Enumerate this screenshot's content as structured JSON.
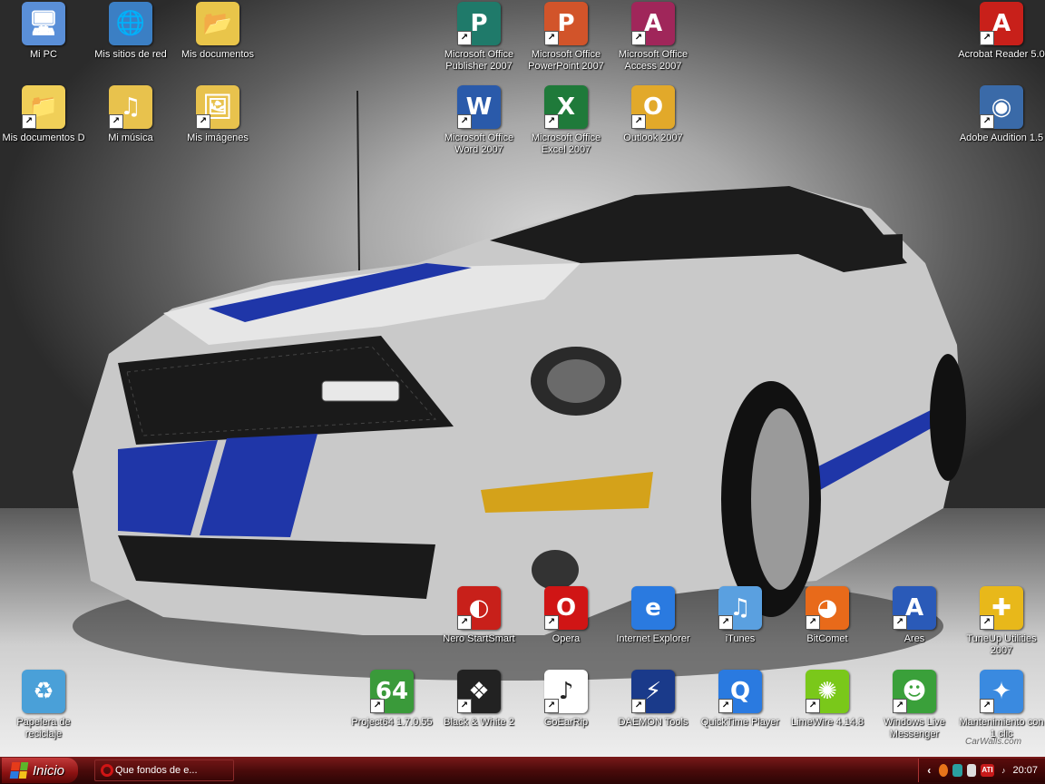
{
  "desktop_icons": [
    {
      "label": "Mi PC",
      "icon": "computer-icon",
      "glyph": "🖥",
      "color": "#5a8fd8",
      "shortcut": false
    },
    {
      "label": "Mis sitios de red",
      "icon": "network-places-icon",
      "glyph": "🌐",
      "color": "#3b7fc4",
      "shortcut": false
    },
    {
      "label": "Mis documentos",
      "icon": "my-documents-icon",
      "glyph": "📂",
      "color": "#e9c54a",
      "shortcut": false
    },
    {
      "label": "Mis documentos D",
      "icon": "folder-icon",
      "glyph": "📁",
      "color": "#f0cf58",
      "shortcut": true
    },
    {
      "label": "Mi música",
      "icon": "music-folder-icon",
      "glyph": "♫",
      "color": "#e8c24d",
      "shortcut": true
    },
    {
      "label": "Mis imágenes",
      "icon": "pictures-folder-icon",
      "glyph": "🖼",
      "color": "#e8c24d",
      "shortcut": true
    },
    {
      "label": "Microsoft Office Publisher 2007",
      "icon": "publisher-icon",
      "glyph": "P",
      "color": "#1f7a6a",
      "shortcut": true
    },
    {
      "label": "Microsoft Office PowerPoint 2007",
      "icon": "powerpoint-icon",
      "glyph": "P",
      "color": "#d2542a",
      "shortcut": true
    },
    {
      "label": "Microsoft Office Access 2007",
      "icon": "access-icon",
      "glyph": "A",
      "color": "#a0265a",
      "shortcut": true
    },
    {
      "label": "Microsoft Office Word 2007",
      "icon": "word-icon",
      "glyph": "W",
      "color": "#2a5aaa",
      "shortcut": true
    },
    {
      "label": "Microsoft Office Excel 2007",
      "icon": "excel-icon",
      "glyph": "X",
      "color": "#1f7a3a",
      "shortcut": true
    },
    {
      "label": "Outlook 2007",
      "icon": "outlook-icon",
      "glyph": "O",
      "color": "#e2a92a",
      "shortcut": true
    },
    {
      "label": "Acrobat Reader 5.0",
      "icon": "acrobat-icon",
      "glyph": "A",
      "color": "#c8201a",
      "shortcut": true
    },
    {
      "label": "Adobe Audition 1.5",
      "icon": "audition-icon",
      "glyph": "◉",
      "color": "#3a6aa8",
      "shortcut": true
    },
    {
      "label": "Nero StartSmart",
      "icon": "nero-icon",
      "glyph": "◐",
      "color": "#c8201a",
      "shortcut": true
    },
    {
      "label": "Opera",
      "icon": "opera-icon",
      "glyph": "O",
      "color": "#d01515",
      "shortcut": true
    },
    {
      "label": "Internet Explorer",
      "icon": "internet-explorer-icon",
      "glyph": "e",
      "color": "#2a7ae0",
      "shortcut": false
    },
    {
      "label": "iTunes",
      "icon": "itunes-icon",
      "glyph": "♫",
      "color": "#5aa0e0",
      "shortcut": true
    },
    {
      "label": "BitComet",
      "icon": "bitcomet-icon",
      "glyph": "◕",
      "color": "#e86a1a",
      "shortcut": true
    },
    {
      "label": "Ares",
      "icon": "ares-icon",
      "glyph": "A",
      "color": "#2a5ab8",
      "shortcut": true
    },
    {
      "label": "TuneUp Utilities 2007",
      "icon": "tuneup-icon",
      "glyph": "✚",
      "color": "#e8b81a",
      "shortcut": true
    },
    {
      "label": "Papelera de reciclaje",
      "icon": "recycle-bin-icon",
      "glyph": "♻",
      "color": "#4aa0d8",
      "shortcut": false
    },
    {
      "label": "Project64 1.7.0.55",
      "icon": "project64-icon",
      "glyph": "64",
      "color": "#3a9a3a",
      "shortcut": true
    },
    {
      "label": "Black & White 2",
      "icon": "black-white-2-icon",
      "glyph": "❖",
      "color": "#222222",
      "shortcut": true
    },
    {
      "label": "GoEarRip",
      "icon": "goearrip-icon",
      "glyph": "♪",
      "color": "#ffffff",
      "shortcut": true
    },
    {
      "label": "DAEMON Tools",
      "icon": "daemon-tools-icon",
      "glyph": "⚡",
      "color": "#1a3a8a",
      "shortcut": true
    },
    {
      "label": "QuickTime Player",
      "icon": "quicktime-icon",
      "glyph": "Q",
      "color": "#2a7ae0",
      "shortcut": true
    },
    {
      "label": "LimeWire 4.14.8",
      "icon": "limewire-icon",
      "glyph": "✺",
      "color": "#7ac81a",
      "shortcut": true
    },
    {
      "label": "Windows Live Messenger",
      "icon": "messenger-icon",
      "glyph": "☻",
      "color": "#3aa03a",
      "shortcut": true
    },
    {
      "label": "Mantenimiento con 1 clic",
      "icon": "maintenance-icon",
      "glyph": "✦",
      "color": "#3a8ae0",
      "shortcut": true
    }
  ],
  "taskbar": {
    "start_label": "Inicio",
    "task_window_label": "Que fondos de e...",
    "clock": "20:07",
    "tray_icons": [
      "chevron-left-icon",
      "firefox-tray-icon",
      "security-tray-icon",
      "network-tray-icon",
      "ati-tray-icon",
      "volume-icon"
    ],
    "tray_ati_label": "ATI"
  },
  "wallpaper": {
    "watermark": "CarWalls.com"
  }
}
